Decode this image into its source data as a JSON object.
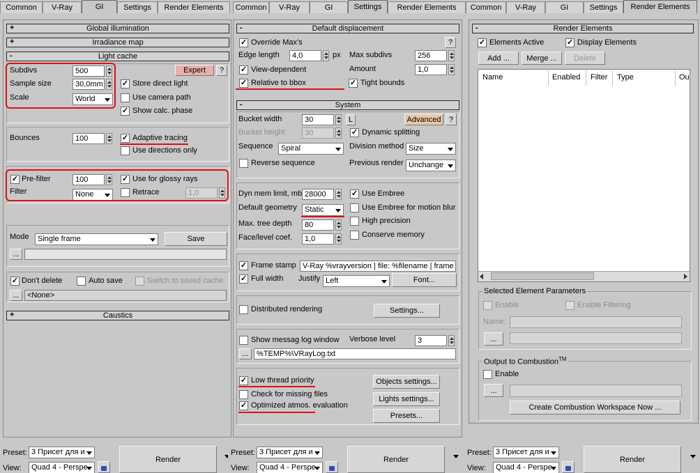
{
  "tabs": [
    "Common",
    "V-Ray",
    "GI",
    "Settings",
    "Render Elements"
  ],
  "left": {
    "rollouts": {
      "gi": "Global illumination",
      "irr": "Irradiance map",
      "lc": "Light cache",
      "caustics": "Caustics"
    },
    "subdivs_label": "Subdivs",
    "subdivs": "500",
    "sample_size_label": "Sample size",
    "sample_size": "30,0mm",
    "scale_label": "Scale",
    "scale": "World",
    "expert": "Expert",
    "help": "?",
    "store_direct": "Store direct light",
    "use_camera": "Use camera path",
    "show_calc": "Show calc. phase",
    "bounces_label": "Bounces",
    "bounces": "100",
    "adaptive": "Adaptive tracing",
    "use_dirs": "Use directions only",
    "prefilter": "Pre-filter",
    "prefilter_val": "100",
    "glossy": "Use for glossy rays",
    "filter_label": "Filter",
    "filter": "None",
    "retrace": "Retrace",
    "retrace_val": "1,0",
    "mode_label": "Mode",
    "mode": "Single frame",
    "save": "Save",
    "dots": "...",
    "dont_delete": "Don't delete",
    "auto_save": "Auto save",
    "switch_saved": "Switch to saved cache",
    "none": "<None>"
  },
  "mid": {
    "rollouts": {
      "disp": "Default displacement",
      "system": "System"
    },
    "override": "Override Max's",
    "help": "?",
    "edge_label": "Edge length",
    "edge": "4,0",
    "px": "px",
    "max_subdivs_label": "Max subdivs",
    "max_subdivs": "256",
    "view_dep": "View-dependent",
    "amount_label": "Amount",
    "amount": "1,0",
    "rel_bbox": "Relative to bbox",
    "tight": "Tight bounds",
    "bucket_w_label": "Bucket width",
    "bucket_w": "30",
    "L": "L",
    "advanced": "Advanced",
    "bucket_h_label": "Bucket height",
    "bucket_h": "30",
    "dyn_split": "Dynamic splitting",
    "sequence_label": "Sequence",
    "sequence": "Spiral",
    "division_label": "Division method",
    "division": "Size",
    "reverse": "Reverse sequence",
    "prev_label": "Previous render",
    "prev": "Unchange",
    "dyn_mem_label": "Dyn mem limit, mb",
    "dyn_mem": "28000",
    "embree": "Use Embree",
    "def_geo_label": "Default geometry",
    "def_geo": "Static",
    "embree_mb": "Use Embree for motion blur",
    "max_tree_label": "Max. tree depth",
    "max_tree": "80",
    "high_prec": "High precision",
    "face_label": "Face/level coef.",
    "face": "1,0",
    "conserve": "Conserve memory",
    "frame_stamp": "Frame stamp",
    "stamp_text": "V-Ray %vrayversion | file: %filename | frame",
    "full_width": "Full width",
    "justify_label": "Justify",
    "justify": "Left",
    "font": "Font...",
    "distributed": "Distributed rendering",
    "settings": "Settings...",
    "show_log": "Show messag log window",
    "verbose_label": "Verbose level",
    "verbose": "3",
    "dots": "...",
    "log_path": "%TEMP%\\VRayLog.txt",
    "low_thread": "Low thread priority",
    "objects": "Objects settings...",
    "check_missing": "Check for missing files",
    "lights": "Lights settings...",
    "opt_atmos": "Optimized atmos. evaluation",
    "presets": "Presets..."
  },
  "right": {
    "rollout": "Render Elements",
    "elements_active": "Elements Active",
    "display_elements": "Display Elements",
    "add": "Add ...",
    "merge": "Merge ...",
    "delete": "Delete",
    "cols": [
      "Name",
      "Enabled",
      "Filter",
      "Type",
      "Ou"
    ],
    "sel_group": "Selected Element Parameters",
    "enable": "Enable",
    "enable_filtering": "Enable Filtering",
    "name_label": "Name:",
    "dots": "...",
    "output_group": "Output to Combustion",
    "tm": "TM",
    "enable2": "Enable",
    "create": "Create Combustion Workspace Now ..."
  },
  "bottom": {
    "preset_label": "Preset:",
    "preset": "3 Присет для и",
    "view_label": "View:",
    "view": "Quad 4 - Perspe",
    "render": "Render"
  }
}
